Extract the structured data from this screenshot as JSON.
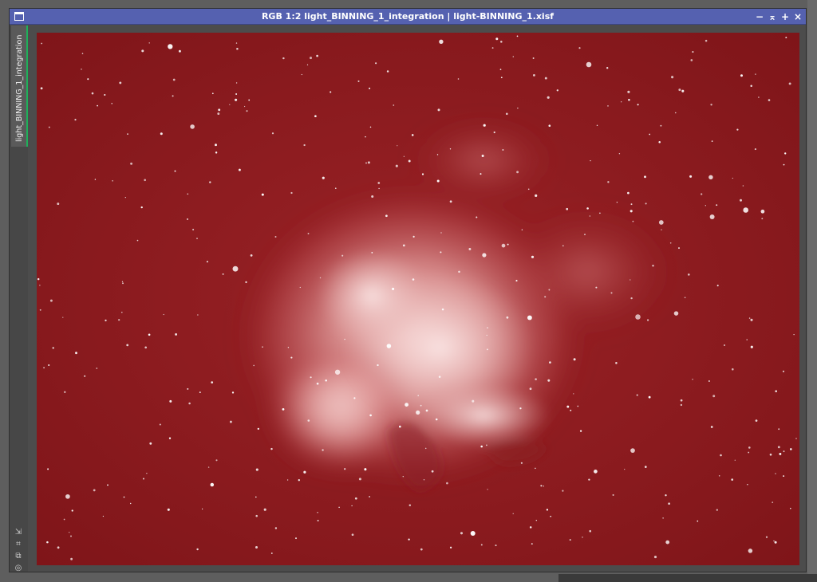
{
  "window": {
    "title": "RGB 1:2 light_BINNING_1_integration | light-BINNING_1.xisf",
    "buttons": {
      "minimize": "−",
      "shade": "⌅",
      "maximize": "+",
      "close": "×"
    }
  },
  "sidebar": {
    "tab_label": "light_BINNING_1_integration",
    "icons": [
      "arrow-icon",
      "crop-icon",
      "clone-icon",
      "target-icon"
    ],
    "icon_glyphs": [
      "⇲",
      "⌗",
      "⧉",
      "◎"
    ]
  },
  "image": {
    "subject": "emission nebula star field",
    "background_color": "#8e1a1e",
    "nebula_color": "#f3c7c5"
  }
}
